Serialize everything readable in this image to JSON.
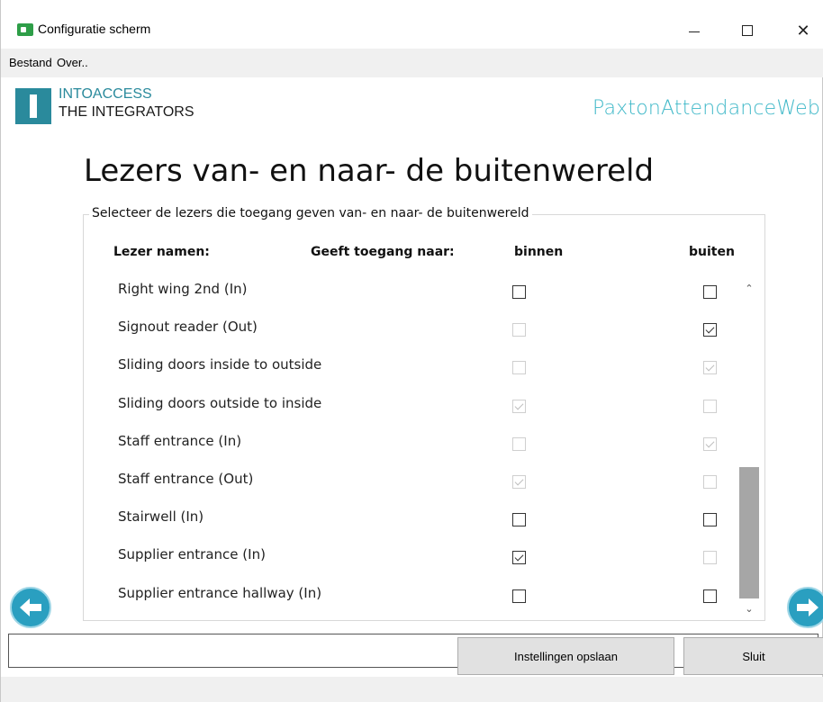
{
  "window": {
    "title": "Configuratie scherm",
    "controls": {
      "minimize": "minimize",
      "maximize": "maximize",
      "close": "✕"
    }
  },
  "menu": {
    "items": [
      "Bestand",
      "Over.."
    ]
  },
  "header": {
    "logo_line1": "INTOACCESS",
    "logo_line2": "THE INTEGRATORS",
    "brand": "PaxtonAttendanceWeb",
    "brand_color": "#3fb8c8",
    "logo_color": "#2a8a9c"
  },
  "page": {
    "title": "Lezers van- en naar- de buitenwereld",
    "group_label": "Selecteer de lezers die toegang geven van- en naar- de buitenwereld"
  },
  "columns": {
    "reader_names": "Lezer namen:",
    "gives_access_to": "Geeft toegang naar:",
    "inside": "binnen",
    "outside": "buiten"
  },
  "readers": [
    {
      "name": "Right wing 2nd (In)",
      "binnen": {
        "checked": false,
        "enabled": true
      },
      "buiten": {
        "checked": false,
        "enabled": true
      }
    },
    {
      "name": "Signout reader (Out)",
      "binnen": {
        "checked": false,
        "enabled": false
      },
      "buiten": {
        "checked": true,
        "enabled": true
      }
    },
    {
      "name": "Sliding doors inside to outside",
      "binnen": {
        "checked": false,
        "enabled": false
      },
      "buiten": {
        "checked": true,
        "enabled": false
      }
    },
    {
      "name": "Sliding doors outside to inside",
      "binnen": {
        "checked": true,
        "enabled": false
      },
      "buiten": {
        "checked": false,
        "enabled": false
      }
    },
    {
      "name": "Staff entrance (In)",
      "binnen": {
        "checked": false,
        "enabled": false
      },
      "buiten": {
        "checked": true,
        "enabled": false
      }
    },
    {
      "name": "Staff entrance (Out)",
      "binnen": {
        "checked": true,
        "enabled": false
      },
      "buiten": {
        "checked": false,
        "enabled": false
      }
    },
    {
      "name": "Stairwell (In)",
      "binnen": {
        "checked": false,
        "enabled": true
      },
      "buiten": {
        "checked": false,
        "enabled": true
      }
    },
    {
      "name": "Supplier entrance (In)",
      "binnen": {
        "checked": true,
        "enabled": true
      },
      "buiten": {
        "checked": false,
        "enabled": false
      }
    },
    {
      "name": "Supplier entrance hallway (In)",
      "binnen": {
        "checked": false,
        "enabled": true
      },
      "buiten": {
        "checked": false,
        "enabled": true
      }
    }
  ],
  "scrollbar": {
    "up_glyph": "⌃",
    "down_glyph": "⌄",
    "position_fraction": 0.92
  },
  "navigation": {
    "back_icon": "arrow-left-icon",
    "forward_icon": "arrow-right-icon"
  },
  "buttons": {
    "save": "Instellingen opslaan",
    "close": "Sluit"
  }
}
